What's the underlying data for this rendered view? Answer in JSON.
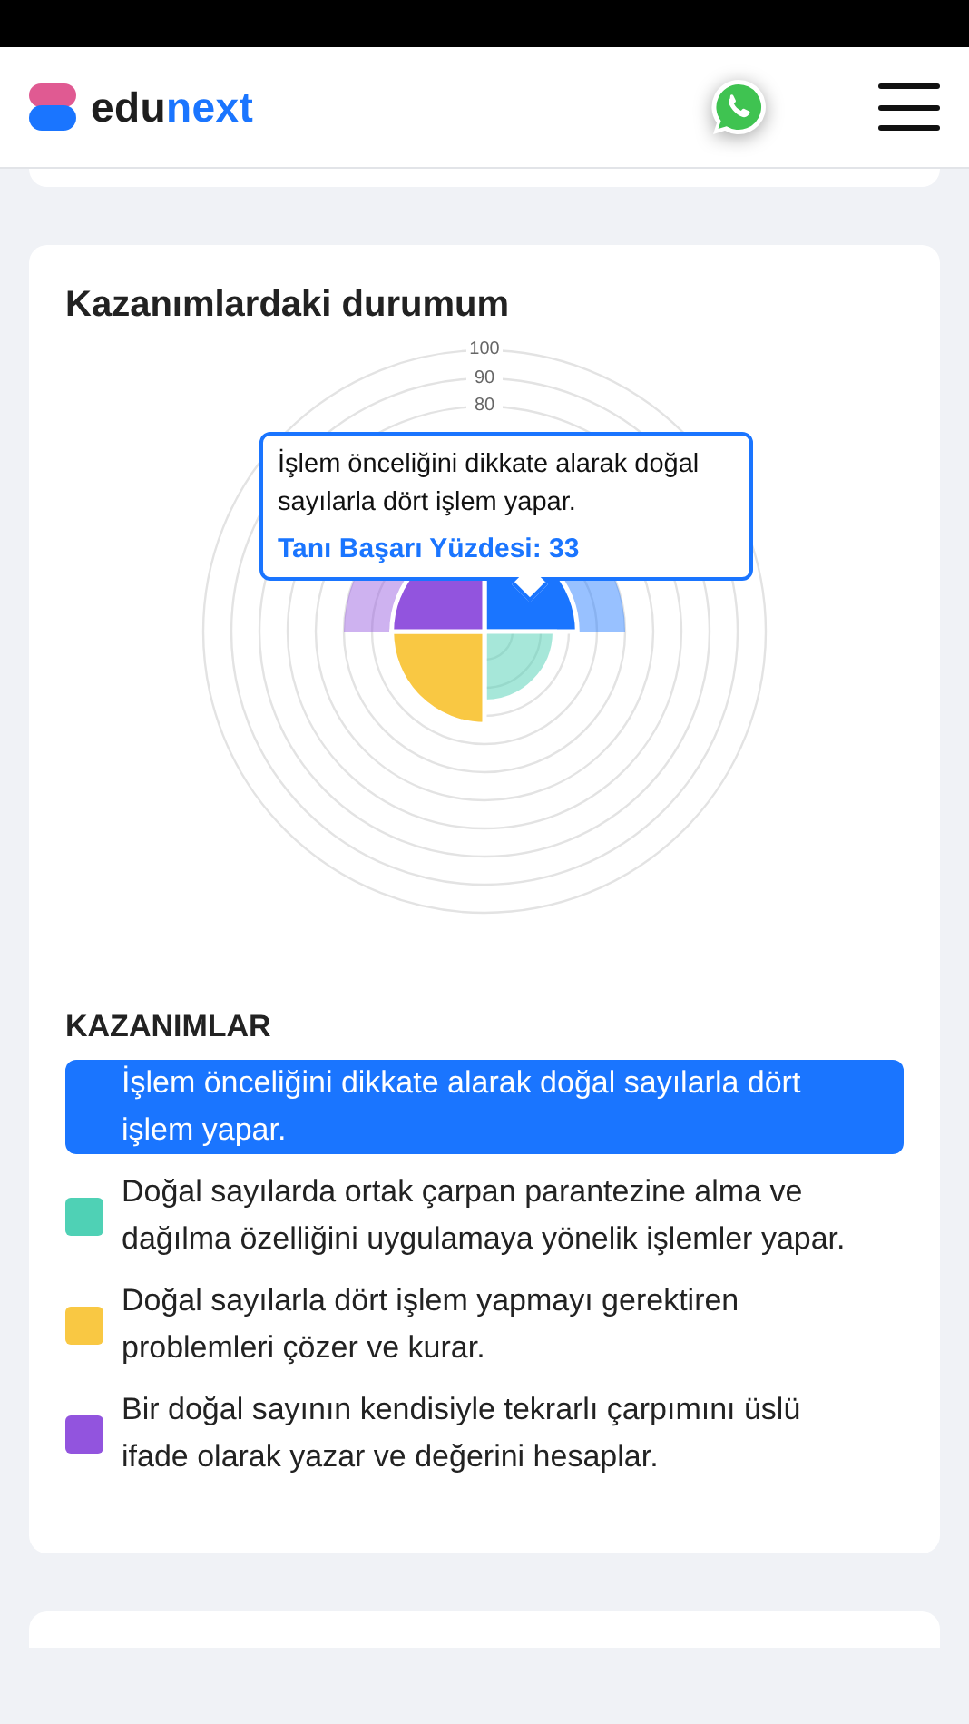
{
  "header": {
    "logo": {
      "part_1": "edu",
      "part_2": "next"
    }
  },
  "card": {
    "title": "Kazanımlardaki durumum",
    "chart": {
      "ticks": [
        "100",
        "90",
        "80"
      ],
      "tooltip": {
        "text": "İşlem önceliğini dikkate alarak doğal sayılarla dört işlem yapar.",
        "value": "Tanı Başarı Yüzdesi: 33"
      }
    },
    "legend_title": "KAZANIMLAR",
    "kazanimlar": [
      {
        "text": "İşlem önceliğini dikkate alarak doğal sayılarla dört işlem yapar.",
        "color": "#1a75ff",
        "selected": true
      },
      {
        "text": "Doğal sayılarda ortak çarpan parantezine alma ve dağılma özelliğini uygulamaya yönelik işlemler yapar.",
        "color": "#4fd1b5",
        "selected": false
      },
      {
        "text": "Doğal sayılarla dört işlem yapmayı gerektiren problemleri çözer ve kurar.",
        "color": "#f9c843",
        "selected": false
      },
      {
        "text": "Bir doğal sayının kendisiyle tekrarlı çarpımını üslü ifade olarak yazar ve değerini hesaplar.",
        "color": "#9254de",
        "selected": false
      }
    ]
  }
}
